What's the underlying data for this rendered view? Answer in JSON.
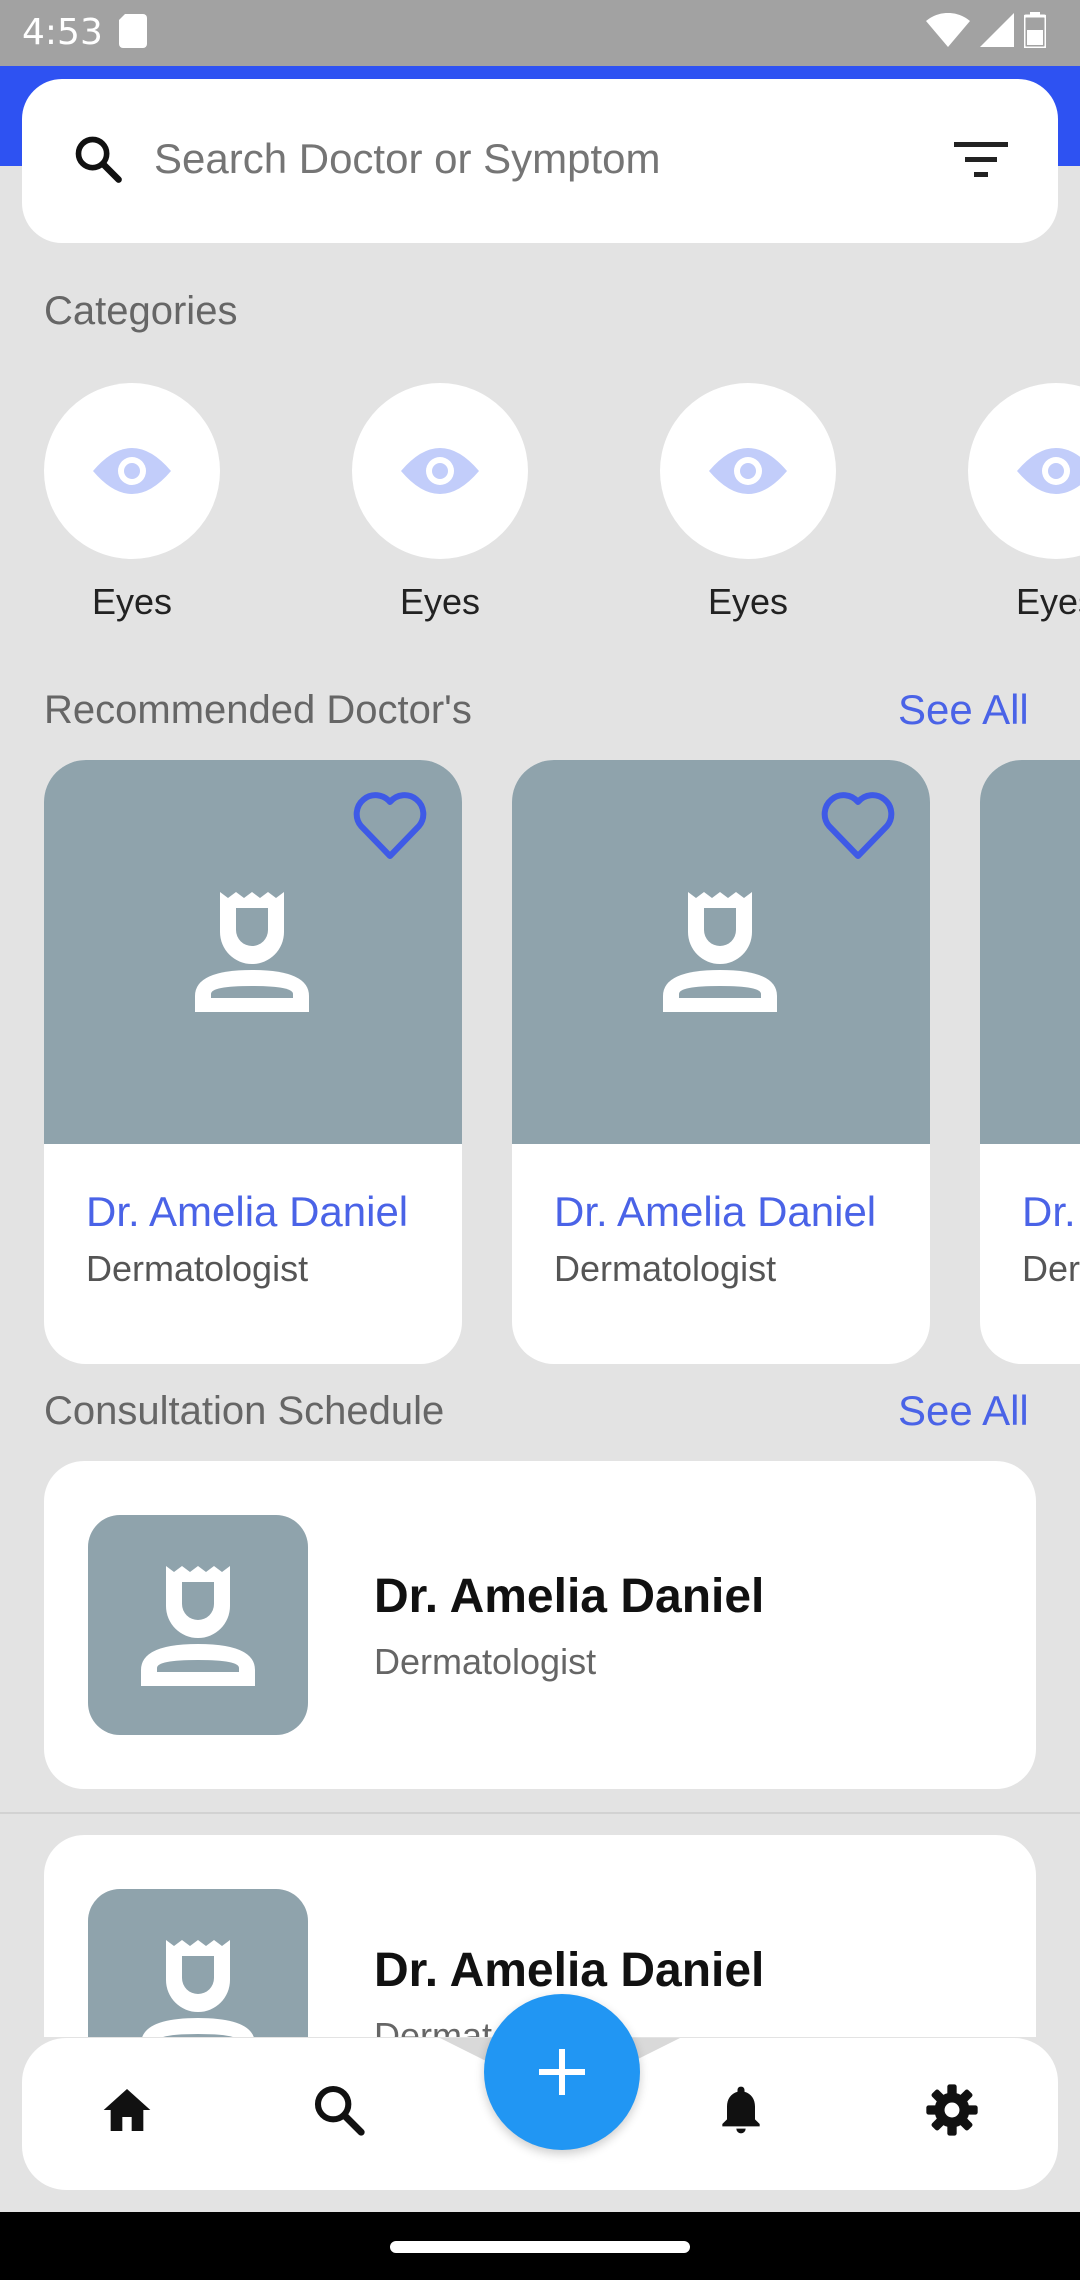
{
  "status_bar": {
    "time": "4:53"
  },
  "search": {
    "placeholder": "Search Doctor or Symptom"
  },
  "categories": {
    "title": "Categories",
    "items": [
      {
        "label": "Eyes",
        "icon": "eye-icon"
      },
      {
        "label": "Eyes",
        "icon": "eye-icon"
      },
      {
        "label": "Eyes",
        "icon": "eye-icon"
      },
      {
        "label": "Eyes",
        "icon": "eye-icon"
      }
    ]
  },
  "recommended": {
    "title": "Recommended Doctor's",
    "see_all": "See All",
    "doctors": [
      {
        "name": "Dr. Amelia Daniel",
        "specialty": "Dermatologist"
      },
      {
        "name": "Dr. Amelia Daniel",
        "specialty": "Dermatologist"
      },
      {
        "name": "Dr. Amelia Daniel",
        "specialty": "Dermatologist"
      }
    ]
  },
  "schedule": {
    "title": "Consultation Schedule",
    "see_all": "See All",
    "items": [
      {
        "name": "Dr. Amelia Daniel",
        "specialty": "Dermatologist"
      },
      {
        "name": "Dr. Amelia Daniel",
        "specialty": "Dermatologist"
      }
    ]
  },
  "bottom_nav": {
    "items": [
      "home-icon",
      "search-icon",
      "add-icon",
      "bell-icon",
      "gear-icon"
    ]
  },
  "colors": {
    "accent": "#4A63E7",
    "header": "#2E52F2",
    "fab": "#2196F3",
    "avatar_bg": "#8FA3AC",
    "background": "#E3E3E3"
  }
}
